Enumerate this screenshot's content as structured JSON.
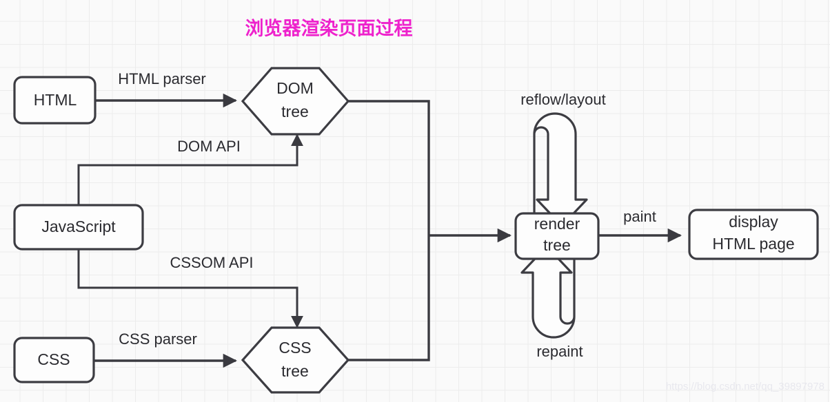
{
  "diagram": {
    "title": "浏览器渲染页面过程",
    "title_color": "#ee22cc",
    "background_color": "#fafafa",
    "grid_color": "#ececec",
    "stroke_color": "#3c3c42",
    "node_fill": "#fdfdfd",
    "watermark": "https://blog.csdn.net/qq_39897978",
    "nodes": [
      {
        "id": "html",
        "label": "HTML",
        "shape": "rounded-rect"
      },
      {
        "id": "dom_tree",
        "label_line1": "DOM",
        "label_line2": "tree",
        "shape": "hexagon"
      },
      {
        "id": "javascript",
        "label": "JavaScript",
        "shape": "rounded-rect"
      },
      {
        "id": "css",
        "label": "CSS",
        "shape": "rounded-rect"
      },
      {
        "id": "css_tree",
        "label_line1": "CSS",
        "label_line2": "tree",
        "shape": "hexagon"
      },
      {
        "id": "render_tree",
        "label_line1": "render",
        "label_line2": "tree",
        "shape": "rounded-rect"
      },
      {
        "id": "display",
        "label_line1": "display",
        "label_line2": "HTML page",
        "shape": "rounded-rect"
      }
    ],
    "edges": [
      {
        "id": "html_to_dom",
        "label": "HTML parser",
        "from": "html",
        "to": "dom_tree"
      },
      {
        "id": "js_to_dom",
        "label": "DOM API",
        "from": "javascript",
        "to": "dom_tree"
      },
      {
        "id": "js_to_csstree",
        "label": "CSSOM API",
        "from": "javascript",
        "to": "css_tree"
      },
      {
        "id": "css_to_csstree",
        "label": "CSS parser",
        "from": "css",
        "to": "css_tree"
      },
      {
        "id": "trees_to_render",
        "label": "",
        "from": "dom_tree",
        "to": "render_tree"
      },
      {
        "id": "render_reflow",
        "label": "reflow/layout",
        "from": "render_tree",
        "to": "render_tree"
      },
      {
        "id": "render_repaint",
        "label": "repaint",
        "from": "render_tree",
        "to": "render_tree"
      },
      {
        "id": "render_to_display",
        "label": "paint",
        "from": "render_tree",
        "to": "display"
      }
    ]
  }
}
